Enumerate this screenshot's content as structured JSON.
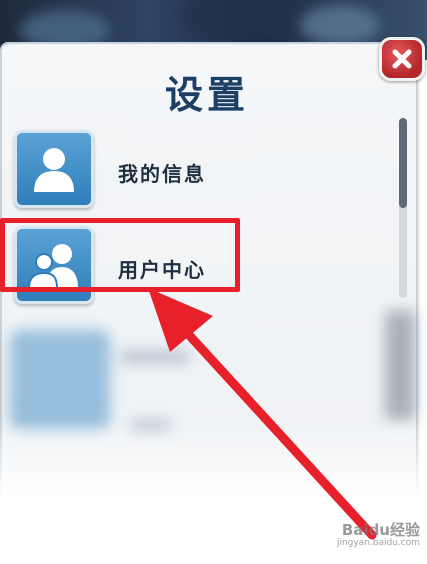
{
  "dialog": {
    "title": "设置",
    "close_icon": "close-x-icon"
  },
  "settings_items": [
    {
      "label": "我的信息",
      "icon": "single-user-icon"
    },
    {
      "label": "用户中心",
      "icon": "user-group-icon",
      "highlighted": true
    }
  ],
  "annotation": {
    "highlight_color": "#e8202a",
    "arrow_color": "#e8202a"
  },
  "watermark": {
    "brand": "Baidu经验",
    "url": "jingyan.baidu.com"
  },
  "colors": {
    "title": "#1c3f66",
    "avatar_tile": "#2f7dba",
    "close_button": "#b3262a"
  }
}
